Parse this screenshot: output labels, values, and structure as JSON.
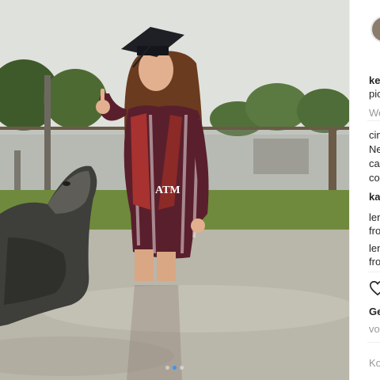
{
  "post": {
    "image_alt": "graduate in cap posing beside alligator in water",
    "carousel": {
      "count": 3,
      "active_index": 0
    }
  },
  "side": {
    "username_fragment": "ke",
    "location_fragment": "pic",
    "follow_fragment": "We",
    "caption_lines": [
      "cin",
      "Ne",
      "ca",
      "co"
    ],
    "comment_1_user": "ka",
    "comment_2_user": "len",
    "comment_2_text": "fro",
    "comment_3_user": "len",
    "comment_3_text": "fro",
    "likes_fragment": "Ge",
    "likes_sub_fragment": "vo",
    "add_comment_fragment": "Ko"
  },
  "colors": {
    "accent_blue": "#3897f0",
    "gown_maroon": "#5a1f2c",
    "stole_red": "#a8322f"
  },
  "icons": [
    "heart-icon"
  ]
}
